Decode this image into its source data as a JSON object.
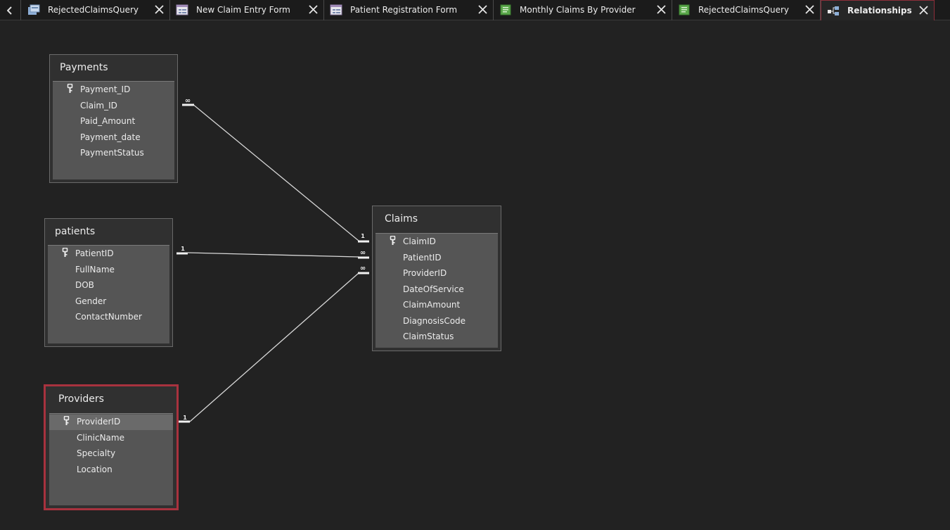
{
  "tabs": [
    {
      "label": "RejectedClaimsQuery",
      "icon": "query-icon",
      "active": false
    },
    {
      "label": "New Claim Entry Form",
      "icon": "form-icon",
      "active": false
    },
    {
      "label": "Patient Registration Form",
      "icon": "form-icon",
      "active": false
    },
    {
      "label": "Monthly Claims By Provider",
      "icon": "report-icon",
      "active": false
    },
    {
      "label": "RejectedClaimsQuery",
      "icon": "report-icon",
      "active": false
    },
    {
      "label": "Relationships",
      "icon": "relationships-icon",
      "active": true
    }
  ],
  "tables": {
    "payments": {
      "title": "Payments",
      "fields": [
        "Payment_ID",
        "Claim_ID",
        "Paid_Amount",
        "Payment_date",
        "PaymentStatus"
      ],
      "primary_key": "Payment_ID"
    },
    "patients": {
      "title": "patients",
      "fields": [
        "PatientID",
        "FullName",
        "DOB",
        "Gender",
        "ContactNumber"
      ],
      "primary_key": "PatientID"
    },
    "providers": {
      "title": "Providers",
      "fields": [
        "ProviderID",
        "ClinicName",
        "Specialty",
        "Location"
      ],
      "primary_key": "ProviderID",
      "selected": true
    },
    "claims": {
      "title": "Claims",
      "fields": [
        "ClaimID",
        "PatientID",
        "ProviderID",
        "DateOfService",
        "ClaimAmount",
        "DiagnosisCode",
        "ClaimStatus"
      ],
      "primary_key": "ClaimID"
    }
  },
  "relationships": [
    {
      "from": "Payments",
      "to": "Claims",
      "from_end": "∞",
      "to_end": "1"
    },
    {
      "from": "patients",
      "to": "Claims",
      "from_end": "1",
      "to_end": "∞"
    },
    {
      "from": "Providers",
      "to": "Claims",
      "from_end": "1",
      "to_end": "∞"
    }
  ],
  "colors": {
    "background": "#222222",
    "accent": "#a8323e",
    "field_area": "#555555"
  }
}
